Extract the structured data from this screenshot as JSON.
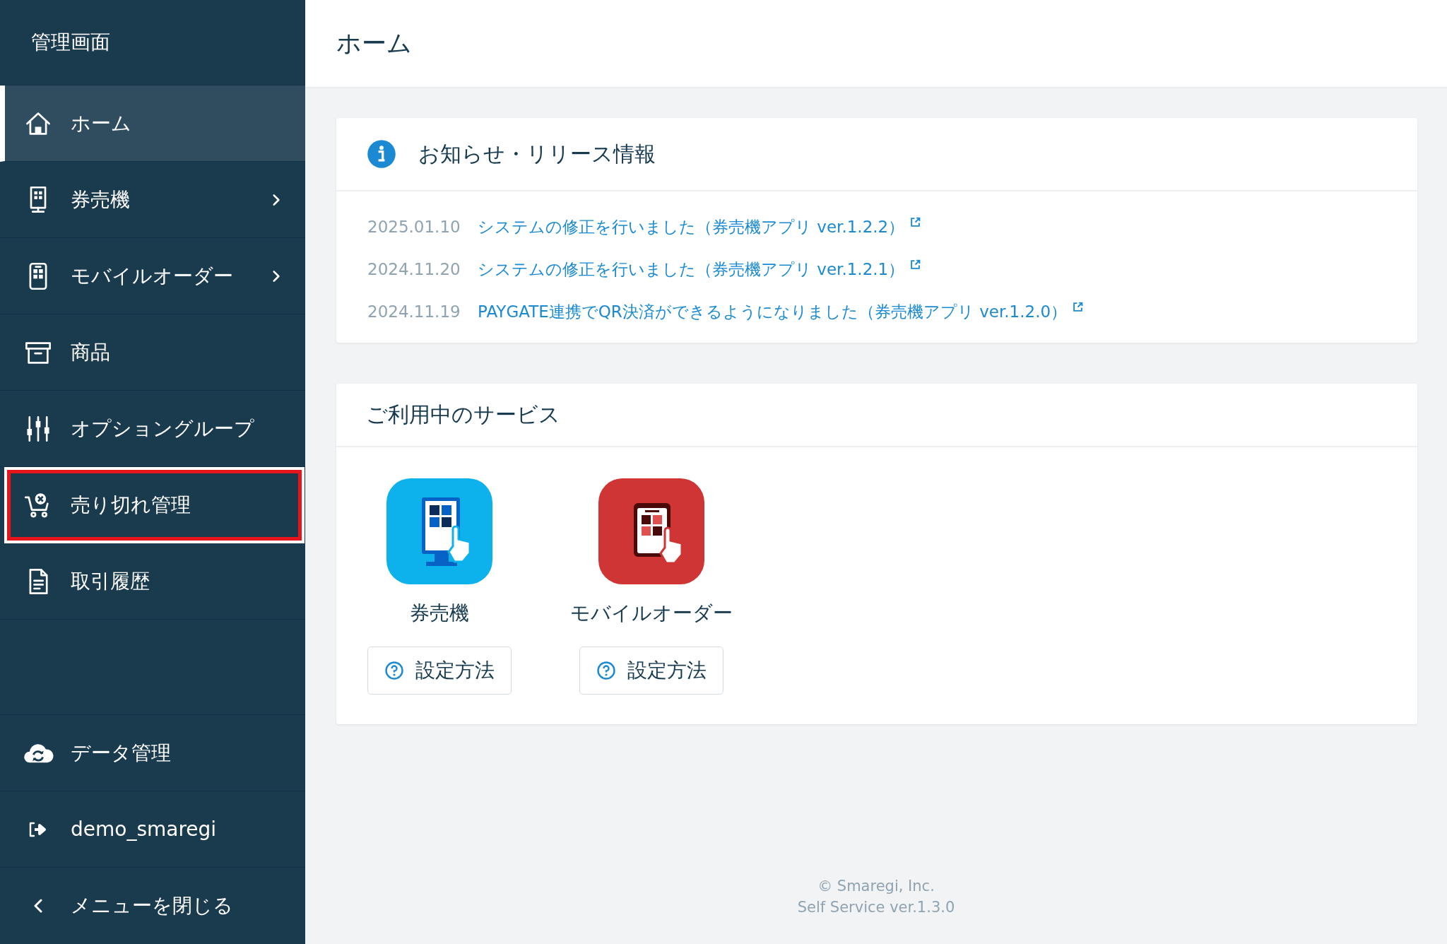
{
  "sidebar": {
    "title": "管理画面",
    "nav_items": [
      {
        "label": "ホーム",
        "selected": true,
        "has_submenu": false,
        "annotated": false
      },
      {
        "label": "券売機",
        "selected": false,
        "has_submenu": true,
        "annotated": false
      },
      {
        "label": "モバイルオーダー",
        "selected": false,
        "has_submenu": true,
        "annotated": false
      },
      {
        "label": "商品",
        "selected": false,
        "has_submenu": false,
        "annotated": false
      },
      {
        "label": "オプショングループ",
        "selected": false,
        "has_submenu": false,
        "annotated": false
      },
      {
        "label": "売り切れ管理",
        "selected": false,
        "has_submenu": false,
        "annotated": true
      },
      {
        "label": "取引履歴",
        "selected": false,
        "has_submenu": false,
        "annotated": false
      }
    ],
    "footer_items": [
      {
        "label": "データ管理"
      },
      {
        "label": "demo_smaregi"
      },
      {
        "label": "メニューを閉じる"
      }
    ]
  },
  "page_title": "ホーム",
  "news": {
    "title": "お知らせ・リリース情報",
    "items": [
      {
        "date": "2025.01.10",
        "text": "システムの修正を行いました（券売機アプリ ver.1.2.2）"
      },
      {
        "date": "2024.11.20",
        "text": "システムの修正を行いました（券売機アプリ ver.1.2.1）"
      },
      {
        "date": "2024.11.19",
        "text": "PAYGATE連携でQR決済ができるようになりました（券売機アプリ ver.1.2.0）"
      }
    ]
  },
  "services": {
    "title": "ご利用中のサービス",
    "items": [
      {
        "kind": "kiosk",
        "name": "券売機",
        "help_button": "設定方法"
      },
      {
        "kind": "mobile",
        "name": "モバイルオーダー",
        "help_button": "設定方法"
      }
    ]
  },
  "footer": {
    "copyright": "© Smaregi, Inc.",
    "version": "Self Service ver.1.3.0"
  }
}
